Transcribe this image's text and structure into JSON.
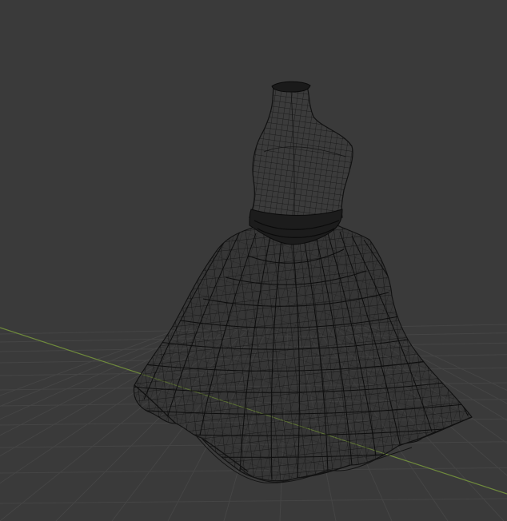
{
  "viewport": {
    "background": "#3a3a3a",
    "grid_color": "#454545",
    "x_axis_color": "#6f8a3c",
    "mesh_color": "#111111",
    "mesh_name": "dress wireframe"
  }
}
